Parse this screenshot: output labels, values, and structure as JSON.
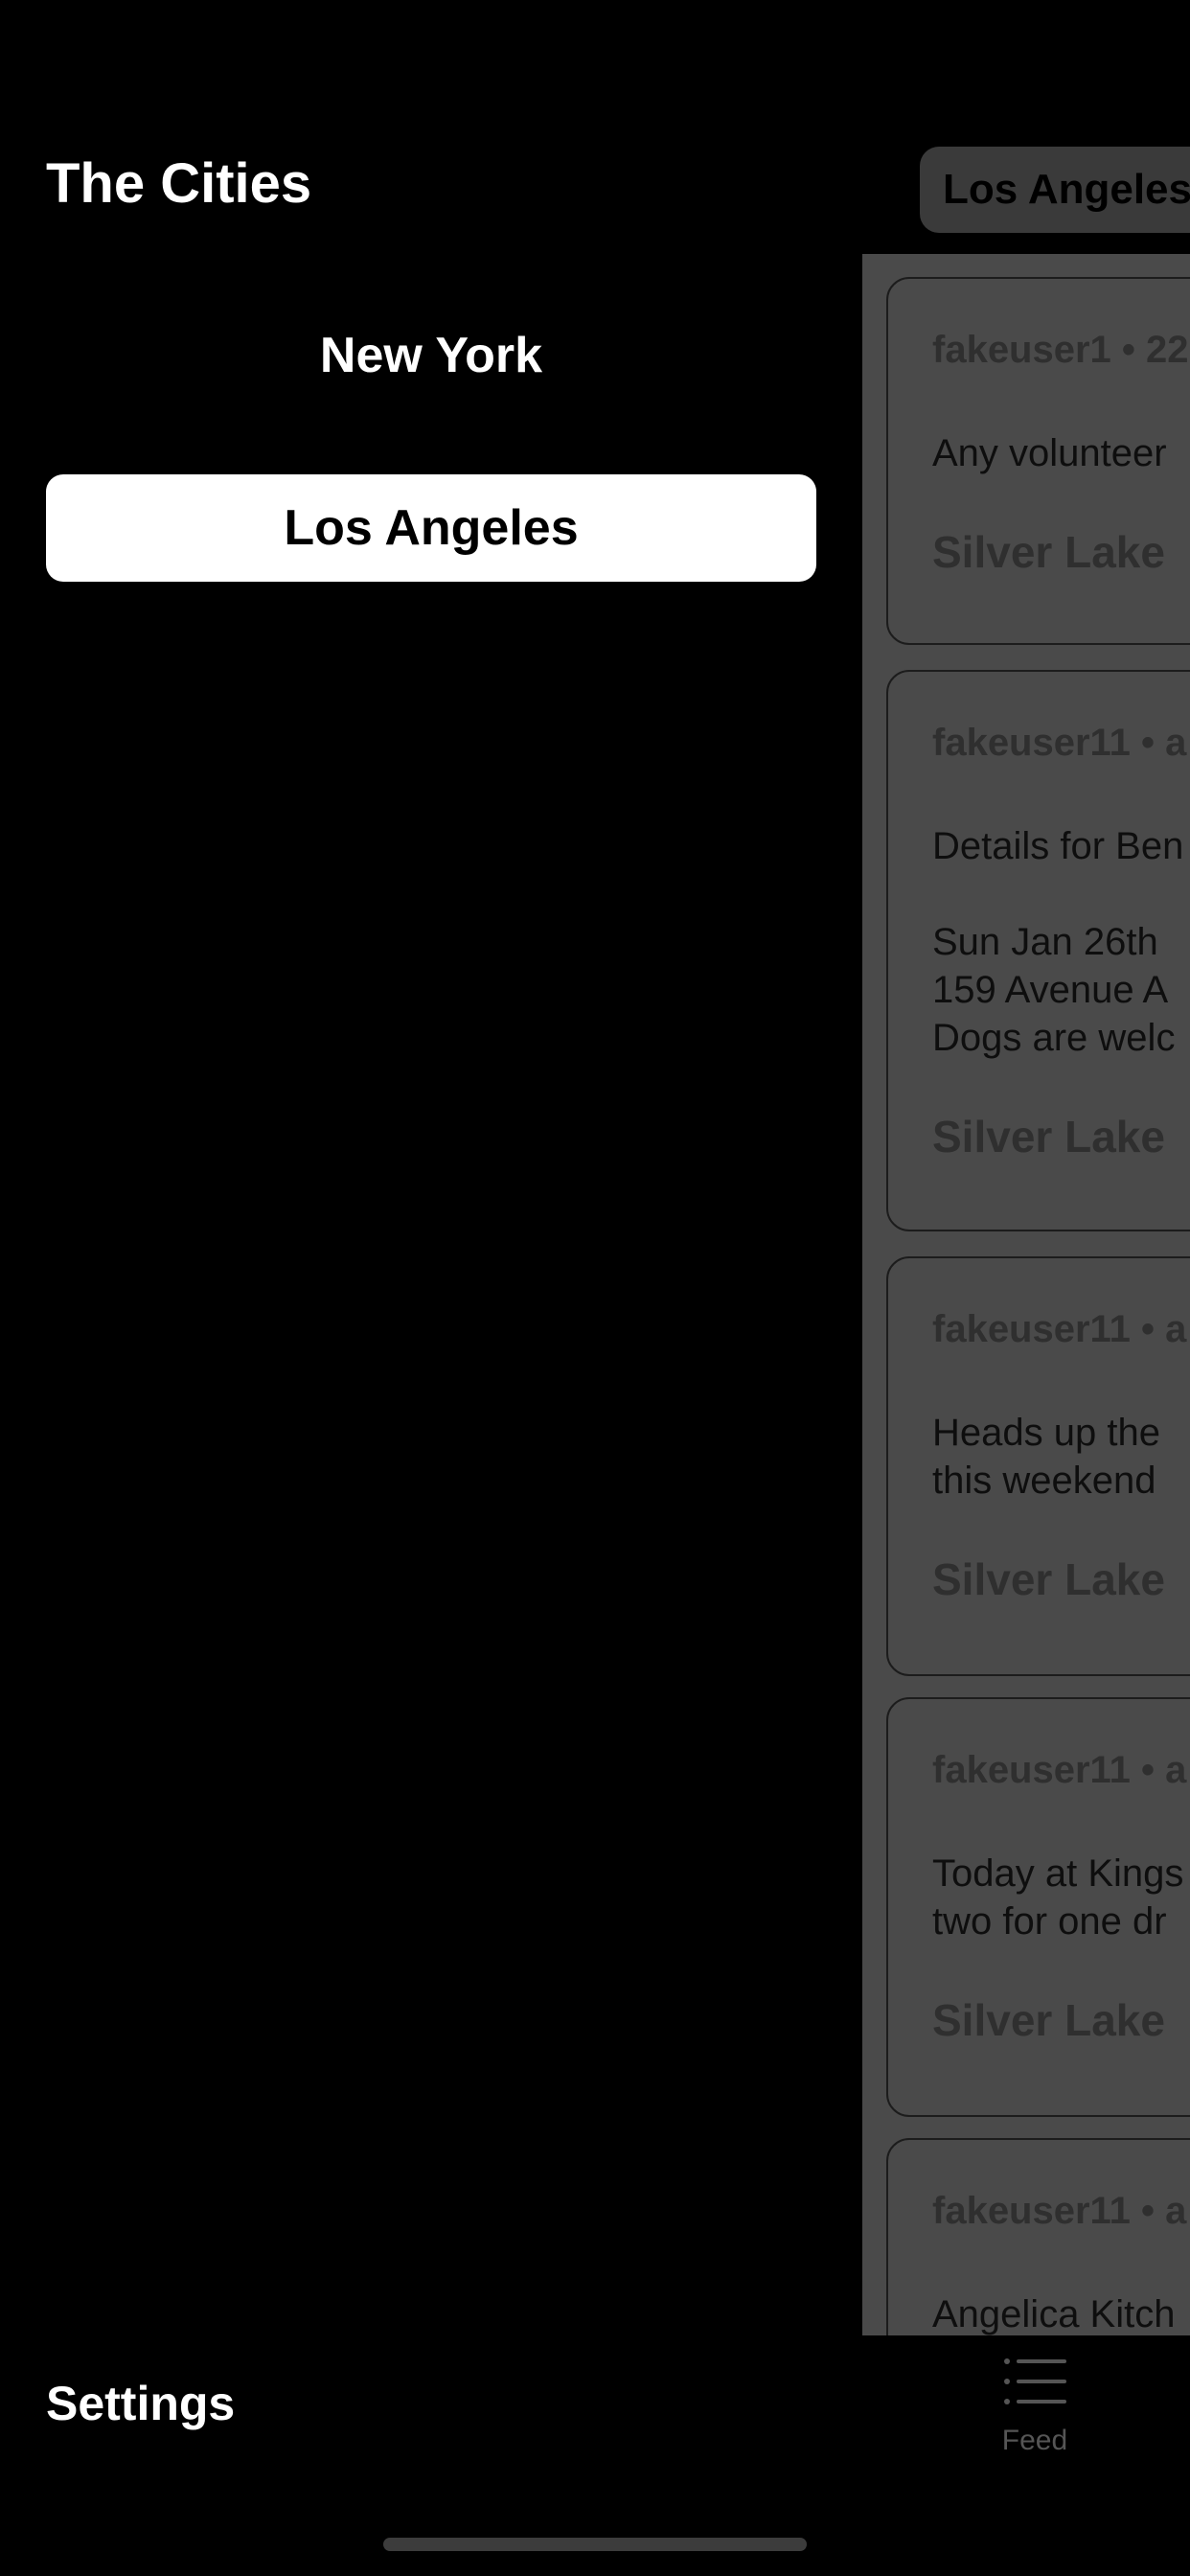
{
  "drawer": {
    "title": "The Cities",
    "cities": [
      {
        "label": "New York",
        "selected": false
      },
      {
        "label": "Los Angeles",
        "selected": true
      }
    ],
    "settings_label": "Settings"
  },
  "main": {
    "city_chip": "Los Angeles",
    "posts": [
      {
        "meta": "fakeuser1 • 22",
        "lines": [
          "Any volunteer"
        ],
        "neighborhood": "Silver Lake"
      },
      {
        "meta": "fakeuser11 • a",
        "lines": [
          "Details for Ben",
          "Sun Jan 26th",
          "159 Avenue A",
          "Dogs are welc"
        ],
        "neighborhood": "Silver Lake"
      },
      {
        "meta": "fakeuser11 • a",
        "lines": [
          "Heads up the",
          "this weekend"
        ],
        "neighborhood": "Silver Lake"
      },
      {
        "meta": "fakeuser11 • a",
        "lines": [
          "Today at Kings",
          "two for one dr"
        ],
        "neighborhood": "Silver Lake"
      },
      {
        "meta": "fakeuser11 • a",
        "lines": [
          "Angelica Kitch"
        ],
        "neighborhood": ""
      }
    ],
    "tab_bar": {
      "feed_label": "Feed",
      "feed_icon": "list-icon"
    }
  },
  "colors": {
    "background": "#000000",
    "selected_city_bg": "#ffffff",
    "dimmed_feed_bg": "#4a4a4a"
  }
}
